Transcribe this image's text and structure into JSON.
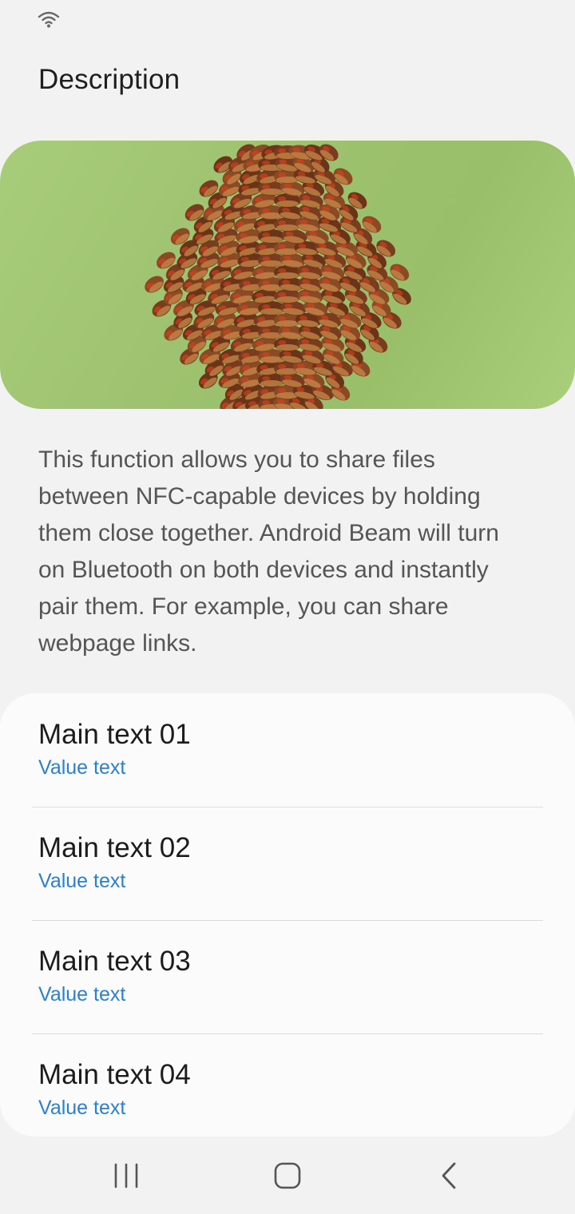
{
  "status_bar": {
    "wifi_icon": "wifi-icon"
  },
  "header": {
    "title": "Description"
  },
  "hero": {
    "image_subject": "pine-cone",
    "background_color": "#9fc46f"
  },
  "description": {
    "text": "This function allows you to share files between NFC-capable devices by holding them close together. Android Beam will turn on Bluetooth on both devices and instantly pair them. For example, you can share webpage links."
  },
  "list": {
    "items": [
      {
        "main": "Main text 01",
        "value": "Value text"
      },
      {
        "main": "Main text 02",
        "value": "Value text"
      },
      {
        "main": "Main text 03",
        "value": "Value text"
      },
      {
        "main": "Main text 04",
        "value": "Value text"
      }
    ],
    "value_color": "#2b7fd4"
  },
  "nav_bar": {
    "recents_icon": "recents-icon",
    "home_icon": "home-icon",
    "back_icon": "back-icon"
  }
}
